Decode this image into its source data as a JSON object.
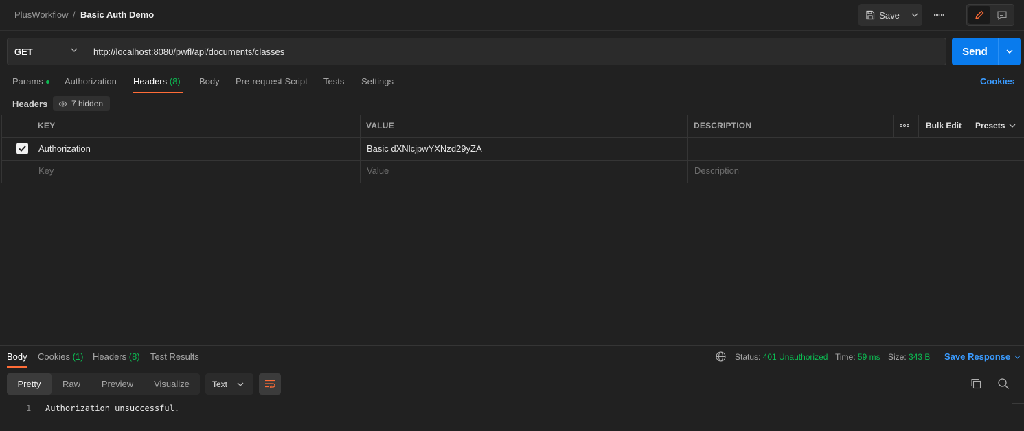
{
  "breadcrumb": {
    "collection": "PlusWorkflow",
    "separator": "/",
    "request": "Basic Auth Demo"
  },
  "toolbar": {
    "save_label": "Save",
    "more_icon": "ellipsis-icon"
  },
  "request": {
    "method": "GET",
    "url": "http://localhost:8080/pwfl/api/documents/classes",
    "send_label": "Send"
  },
  "request_tabs": {
    "params": "Params",
    "authorization": "Authorization",
    "headers": "Headers",
    "headers_count": "(8)",
    "body": "Body",
    "prerequest": "Pre-request Script",
    "tests": "Tests",
    "settings": "Settings",
    "cookies": "Cookies"
  },
  "headers_section": {
    "label": "Headers",
    "hidden": "7 hidden"
  },
  "headers_table": {
    "columns": {
      "key": "KEY",
      "value": "VALUE",
      "description": "DESCRIPTION"
    },
    "bulk_edit": "Bulk Edit",
    "presets": "Presets",
    "rows": [
      {
        "enabled": true,
        "key": "Authorization",
        "value": "Basic dXNlcjpwYXNzd29yZA==",
        "description": ""
      }
    ],
    "placeholders": {
      "key": "Key",
      "value": "Value",
      "description": "Description"
    }
  },
  "response": {
    "tabs": {
      "body": "Body",
      "cookies": "Cookies",
      "cookies_count": "(1)",
      "headers": "Headers",
      "headers_count": "(8)",
      "test_results": "Test Results"
    },
    "status_label": "Status:",
    "status_value": "401 Unauthorized",
    "time_label": "Time:",
    "time_value": "59 ms",
    "size_label": "Size:",
    "size_value": "343 B",
    "save_response": "Save Response",
    "views": {
      "pretty": "Pretty",
      "raw": "Raw",
      "preview": "Preview",
      "visualize": "Visualize"
    },
    "format": "Text",
    "lines": [
      {
        "num": "1",
        "text": "Authorization unsuccessful."
      }
    ]
  },
  "colors": {
    "accent_orange": "#ff6c37",
    "send_blue": "#097bed",
    "link_blue": "#3a9bff",
    "success_green": "#0cbb52",
    "background": "#212121"
  }
}
